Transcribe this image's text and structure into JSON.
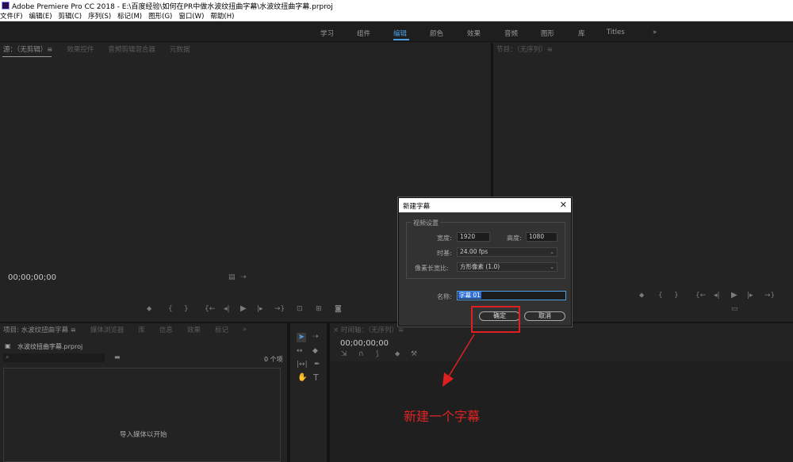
{
  "window": {
    "title": "Adobe Premiere Pro CC 2018 - E:\\百度经验\\如何在PR中做水波纹扭曲字幕\\水波纹扭曲字幕.prproj"
  },
  "menu": [
    "文件(F)",
    "编辑(E)",
    "剪辑(C)",
    "序列(S)",
    "标记(M)",
    "图形(G)",
    "窗口(W)",
    "帮助(H)"
  ],
  "workspaces": {
    "tabs": [
      "学习",
      "组件",
      "编辑",
      "颜色",
      "效果",
      "音频",
      "图形",
      "库",
      "Titles"
    ],
    "active": "编辑",
    "more": "»"
  },
  "source_panel": {
    "tabs": [
      "源：（无剪辑）≡",
      "效果控件",
      "音频剪辑混合器",
      "元数据"
    ],
    "timecode": "00;00;00;00"
  },
  "program_panel": {
    "tabs": [
      "节目：（无序列）≡"
    ]
  },
  "project_panel": {
    "tabs": [
      "项目: 水波纹扭曲字幕 ≡",
      "媒体浏览器",
      "库",
      "信息",
      "效果",
      "标记",
      "»"
    ],
    "project_file": "水波纹扭曲字幕.prproj",
    "item_count": "0 个项",
    "empty_hint": "导入媒体以开始"
  },
  "timeline_panel": {
    "tabs": [
      "× 时间轴：（无序列）≡"
    ],
    "timecode": "00;00;00;00"
  },
  "dialog": {
    "title": "新建字幕",
    "close": "✕",
    "group_label": "视频设置",
    "width_label": "宽度:",
    "width_value": "1920",
    "height_label": "高度:",
    "height_value": "1080",
    "timebase_label": "时基:",
    "timebase_value": "24.00 fps",
    "par_label": "像素长宽比:",
    "par_value": "方形像素 (1.0)",
    "name_label": "名称:",
    "name_value": "字幕 01",
    "ok_label": "确定",
    "cancel_label": "取消"
  },
  "annotation": {
    "text": "新建一个字幕",
    "color": "#e02424"
  },
  "colors": {
    "accent": "#4d9de0",
    "annotation_red": "#e02020"
  }
}
